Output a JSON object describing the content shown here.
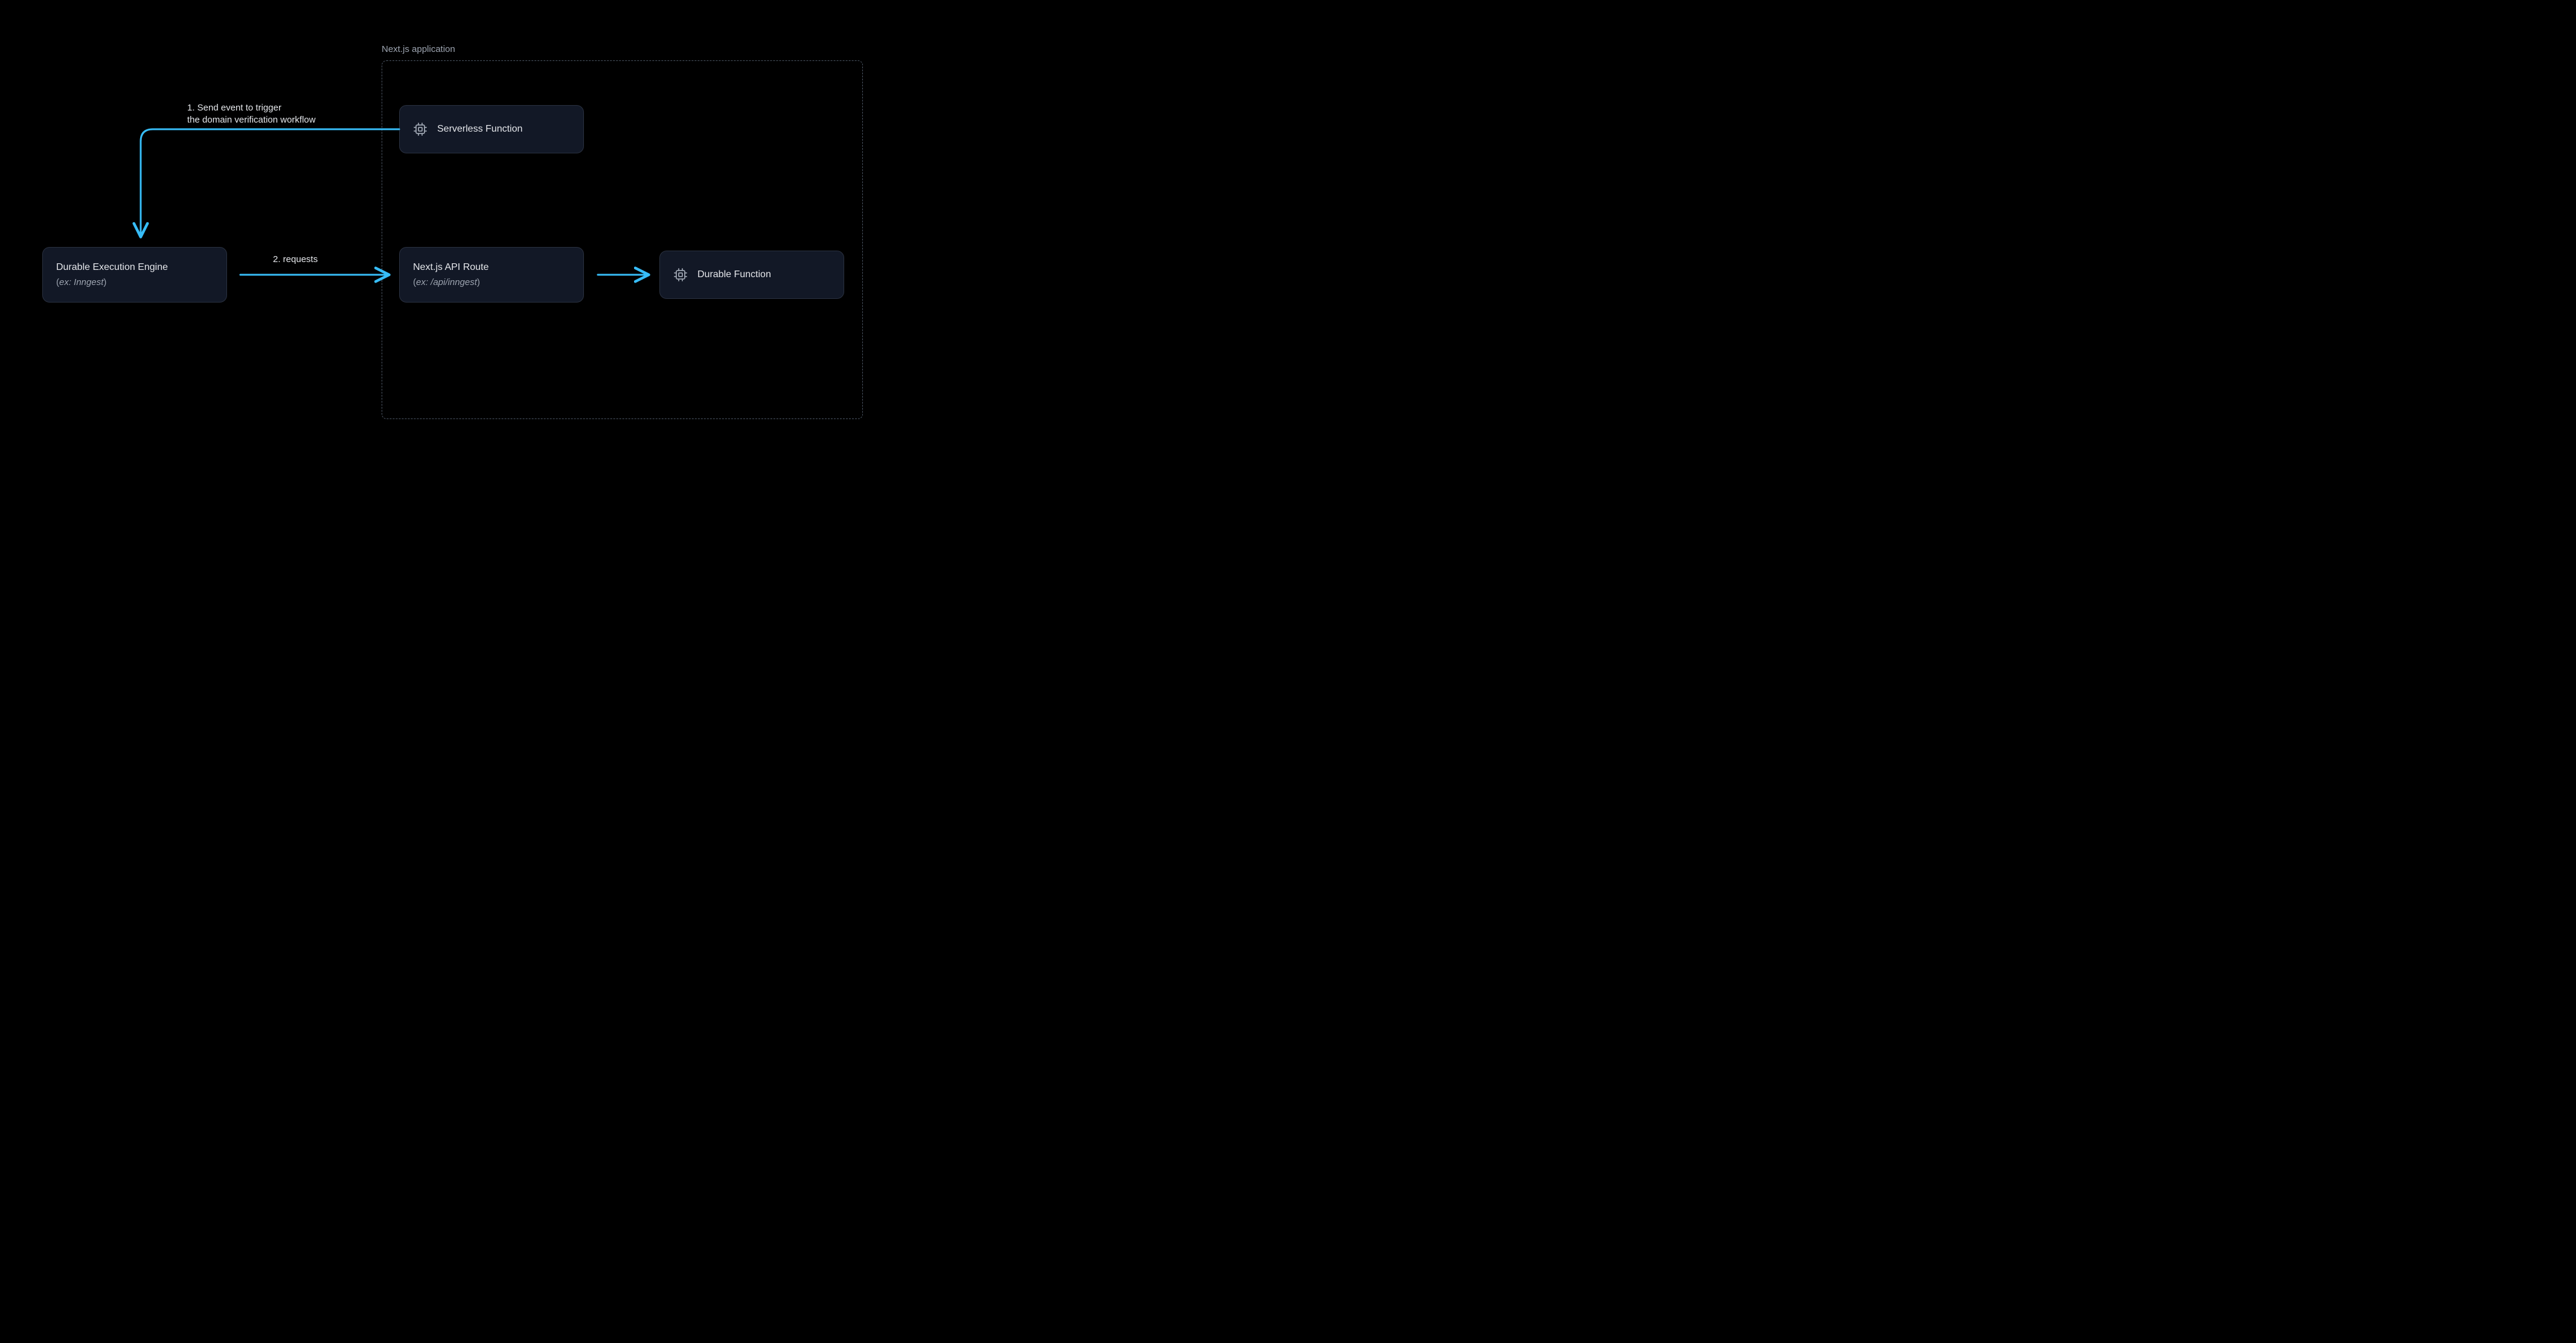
{
  "group": {
    "label": "Next.js application"
  },
  "nodes": {
    "serverless": {
      "title": "Serverless Function"
    },
    "durableEngine": {
      "title": "Durable Execution Engine",
      "sub_prefix": "(",
      "sub_italic": "ex: Inngest",
      "sub_suffix": ")"
    },
    "apiRoute": {
      "title": "Next.js API Route",
      "sub_prefix": "(",
      "sub_italic": "ex: /api/inngest",
      "sub_suffix": ")"
    },
    "durableFunction": {
      "title": "Durable Function"
    }
  },
  "edges": {
    "eventTrigger": {
      "line1": "1. Send event to trigger",
      "line2": "the domain verification workflow"
    },
    "requests": {
      "label": "2. requests"
    }
  },
  "colors": {
    "accent": "#37bdf8"
  }
}
